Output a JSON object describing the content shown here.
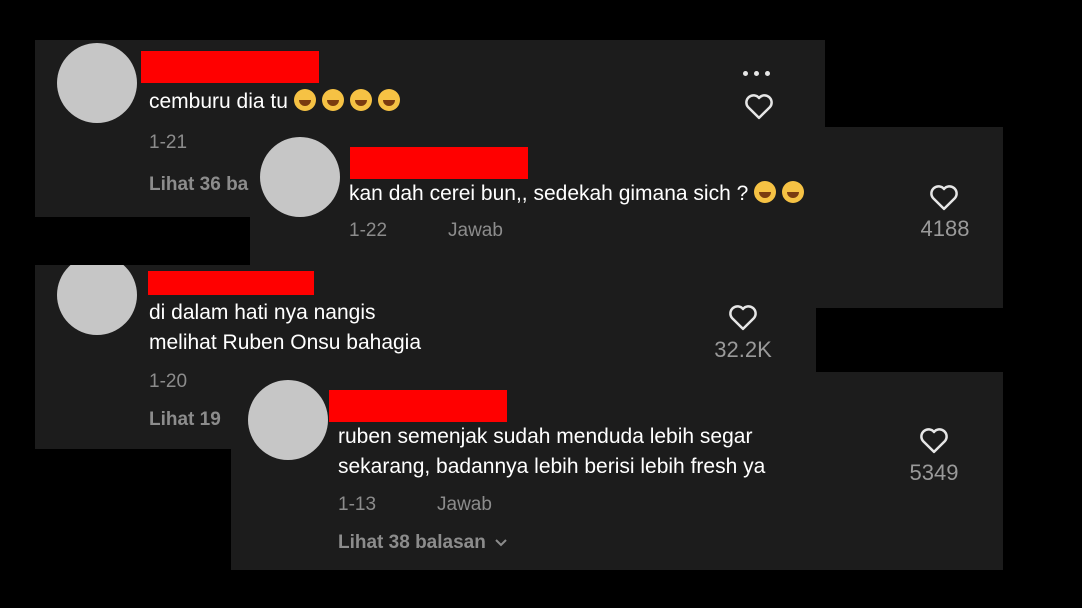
{
  "colors": {
    "background": "#000000",
    "card": "#1c1c1c",
    "redaction": "#ff0000",
    "avatar": "#c6c6c6"
  },
  "comments": [
    {
      "text_lines": [
        "cemburu dia tu"
      ],
      "emoji": [
        "face-with-tears-of-joy",
        "face-with-tears-of-joy",
        "face-with-tears-of-joy",
        "face-with-tears-of-joy"
      ],
      "date": "1-21",
      "view_replies": "Lihat 36 ba",
      "more_icon": "ellipsis-icon"
    },
    {
      "text_lines": [
        "kan dah cerei bun,, sedekah gimana sich ?"
      ],
      "emoji": [
        "rolling-on-floor-laughing",
        "rolling-on-floor-laughing"
      ],
      "date": "1-22",
      "reply": "Jawab",
      "likes": "4188"
    },
    {
      "text_lines": [
        "di dalam hati nya nangis",
        "melihat Ruben Onsu bahagia"
      ],
      "date": "1-20",
      "view_replies": "Lihat 19",
      "likes": "32.2K"
    },
    {
      "text_lines": [
        "ruben semenjak sudah menduda lebih segar",
        "sekarang, badannya lebih berisi lebih fresh ya"
      ],
      "date": "1-13",
      "reply": "Jawab",
      "view_replies": "Lihat 38 balasan",
      "likes": "5349"
    }
  ]
}
